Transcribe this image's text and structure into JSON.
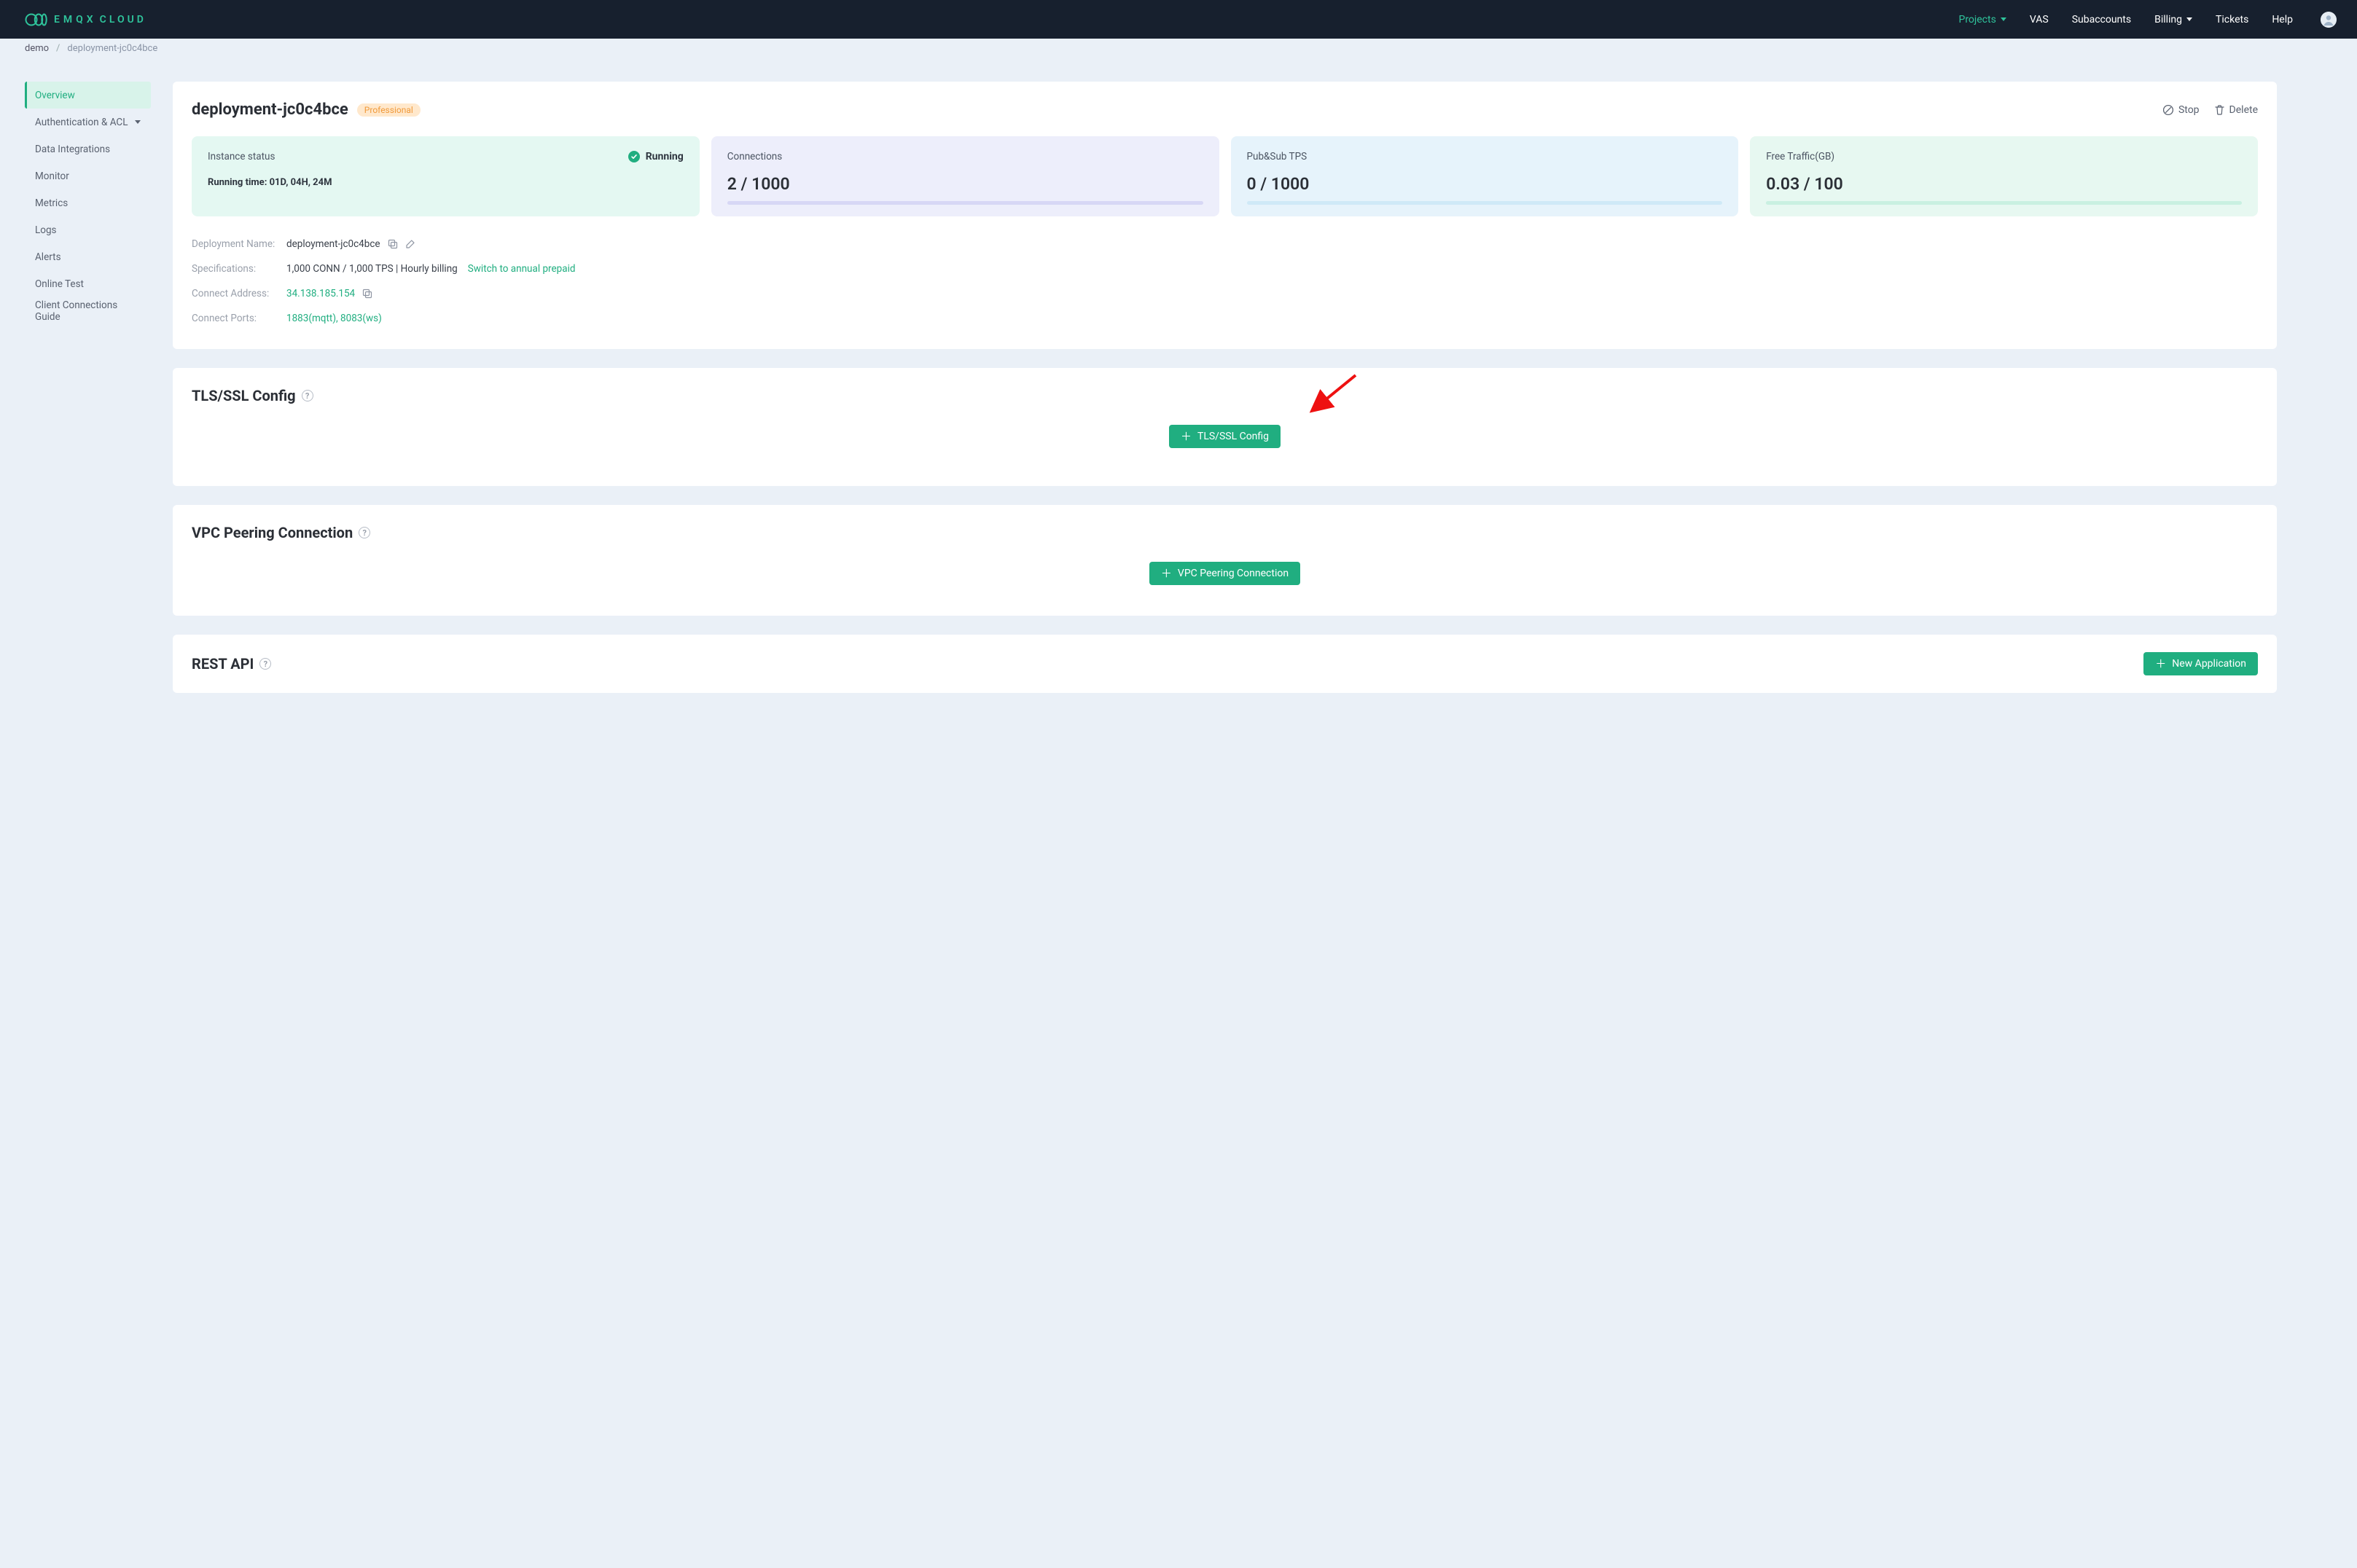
{
  "brand": {
    "name": "EMQX",
    "suffix": "CLOUD"
  },
  "nav": {
    "projects": "Projects",
    "vas": "VAS",
    "subaccounts": "Subaccounts",
    "billing": "Billing",
    "tickets": "Tickets",
    "help": "Help"
  },
  "breadcrumb": {
    "root": "demo",
    "current": "deployment-jc0c4bce"
  },
  "sidebar": {
    "overview": "Overview",
    "auth": "Authentication & ACL",
    "integrations": "Data Integrations",
    "monitor": "Monitor",
    "metrics": "Metrics",
    "logs": "Logs",
    "alerts": "Alerts",
    "online_test": "Online Test",
    "client_guide": "Client Connections Guide"
  },
  "header": {
    "title": "deployment-jc0c4bce",
    "badge": "Professional",
    "stop": "Stop",
    "delete": "Delete"
  },
  "cards": {
    "status_label": "Instance status",
    "status_value": "Running",
    "running_time_label": "Running time:",
    "running_time_value": "01D, 04H, 24M",
    "conn_label": "Connections",
    "conn_value": "2 / 1000",
    "tps_label": "Pub&Sub TPS",
    "tps_value": "0 / 1000",
    "traffic_label": "Free Traffic(GB)",
    "traffic_value": "0.03 / 100"
  },
  "details": {
    "name_k": "Deployment Name:",
    "name_v": "deployment-jc0c4bce",
    "spec_k": "Specifications:",
    "spec_v": "1,000 CONN / 1,000 TPS | Hourly billing",
    "spec_link": "Switch to annual prepaid",
    "addr_k": "Connect Address:",
    "addr_v": "34.138.185.154",
    "ports_k": "Connect Ports:",
    "ports_v": "1883(mqtt), 8083(ws)"
  },
  "tls": {
    "title": "TLS/SSL Config",
    "btn": "TLS/SSL Config"
  },
  "vpc": {
    "title": "VPC Peering Connection",
    "btn": "VPC Peering Connection"
  },
  "api": {
    "title": "REST API",
    "btn": "New Application"
  }
}
